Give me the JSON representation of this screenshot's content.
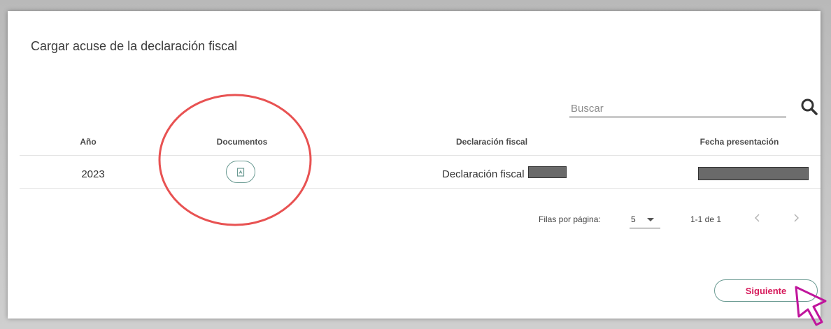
{
  "page": {
    "title": "Cargar acuse de la declaración fiscal"
  },
  "search": {
    "placeholder": "Buscar",
    "icon": "search-icon"
  },
  "table": {
    "columns": [
      "Año",
      "Documentos",
      "Declaración fiscal",
      "Fecha presentación"
    ],
    "rows": [
      {
        "year": "2023",
        "document_icon": "pdf-document-icon",
        "declaration": "Declaración fiscal",
        "declaration_suffix_redacted": true,
        "date_redacted": true
      }
    ]
  },
  "pagination": {
    "rows_per_page_label": "Filas por página:",
    "rows_per_page_value": "5",
    "range_text": "1-1 de 1",
    "prev_icon": "chevron-left-icon",
    "next_icon": "chevron-right-icon"
  },
  "actions": {
    "next_label": "Siguiente"
  },
  "annotations": {
    "highlight_color": "#e85252",
    "cursor_color": "#c0159c"
  },
  "colors": {
    "accent": "#d6195a",
    "button_border": "#6a9a92"
  }
}
